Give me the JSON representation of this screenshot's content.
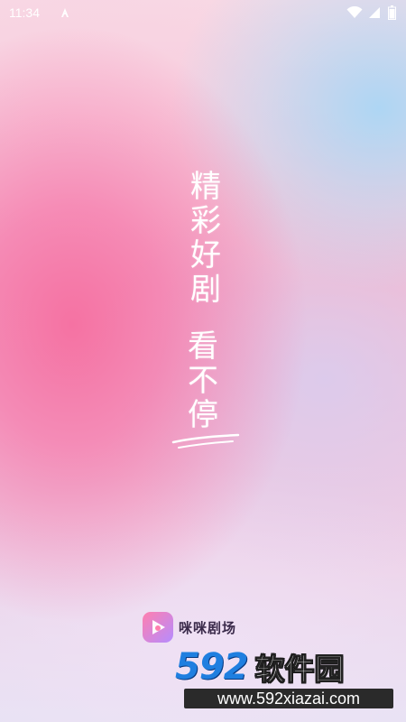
{
  "status_bar": {
    "time": "11:34",
    "icons": [
      "a-notification-icon",
      "wifi-icon",
      "signal-icon",
      "battery-icon"
    ]
  },
  "slogan": {
    "column1": [
      "精",
      "彩",
      "好",
      "剧"
    ],
    "column2": [
      "看",
      "不",
      "停"
    ]
  },
  "brand": {
    "name": "咪咪剧场",
    "logo_icon": "play-heart-icon"
  },
  "watermark": {
    "number": "592",
    "text": "软件园",
    "url": "www.592xiazai.com"
  },
  "colors": {
    "accent_pink": "#f56ea0",
    "accent_blue": "#aad7f5",
    "watermark_blue": "#1f7fe0"
  }
}
